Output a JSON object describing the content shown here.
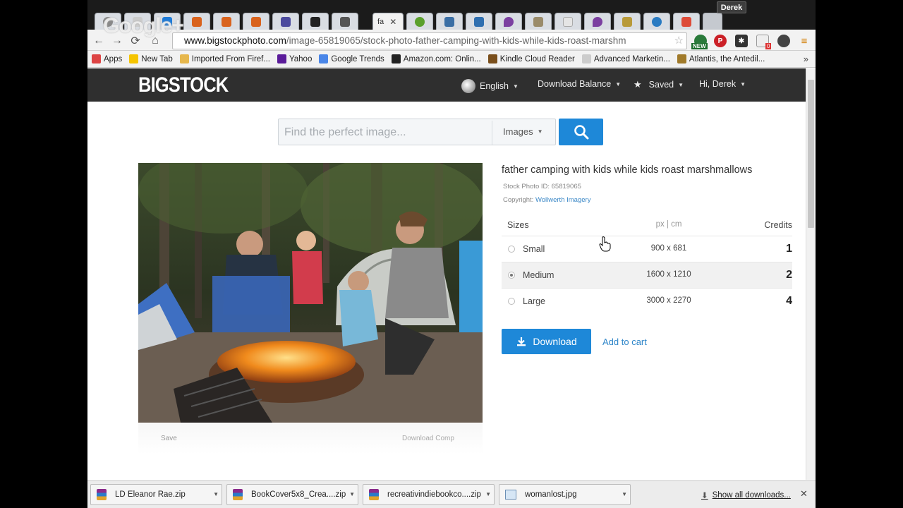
{
  "browser": {
    "profile_name": "Derek",
    "active_tab_label": "fa",
    "url_host": "www.bigstockphoto.com",
    "url_path": "/image-65819065/stock-photo-father-camping-with-kids-while-kids-roast-marshm",
    "overlay_logo": "Google+",
    "bookmarks": [
      {
        "label": "Apps",
        "color": "#d44"
      },
      {
        "label": "New Tab",
        "color": "#f5c400"
      },
      {
        "label": "Imported From Firef...",
        "color": "#e6b74d"
      },
      {
        "label": "Yahoo",
        "color": "#5b1c9a"
      },
      {
        "label": "Google Trends",
        "color": "#4a86e8"
      },
      {
        "label": "Amazon.com: Onlin...",
        "color": "#222"
      },
      {
        "label": "Kindle Cloud Reader",
        "color": "#7a4f1c"
      },
      {
        "label": "Advanced Marketin...",
        "color": "#ccc"
      },
      {
        "label": "Atlantis, the Antedil...",
        "color": "#a07a2a"
      }
    ],
    "extension_new_badge": "NEW",
    "extension_count": "0"
  },
  "site": {
    "logo": "BIGSTOCK",
    "nav": {
      "language": "English",
      "download_balance": "Download Balance",
      "saved": "Saved",
      "greeting": "Hi, Derek"
    },
    "search": {
      "placeholder": "Find the perfect image...",
      "type_label": "Images"
    },
    "photo": {
      "save_label": "Save",
      "comp_label": "Download Comp"
    },
    "details": {
      "title": "father camping with kids while kids roast marshmallows",
      "stock_id": "Stock Photo ID: 65819065",
      "copyright_label": "Copyright:",
      "copyright_owner": "Wollwerth Imagery",
      "sizes_header": {
        "col1": "Sizes",
        "col2": "px | cm",
        "col3": "Credits"
      },
      "sizes": [
        {
          "name": "Small",
          "dims": "900 x 681",
          "credits": "1",
          "selected": false
        },
        {
          "name": "Medium",
          "dims": "1600 x 1210",
          "credits": "2",
          "selected": true
        },
        {
          "name": "Large",
          "dims": "3000 x 2270",
          "credits": "4",
          "selected": false
        }
      ],
      "download_label": "Download",
      "add_to_cart_label": "Add to cart"
    }
  },
  "download_shelf": {
    "items": [
      "LD Eleanor Rae.zip",
      "BookCover5x8_Crea....zip",
      "recreativindiebookco....zip",
      "womanlost.jpg"
    ],
    "show_all": "Show all downloads..."
  }
}
